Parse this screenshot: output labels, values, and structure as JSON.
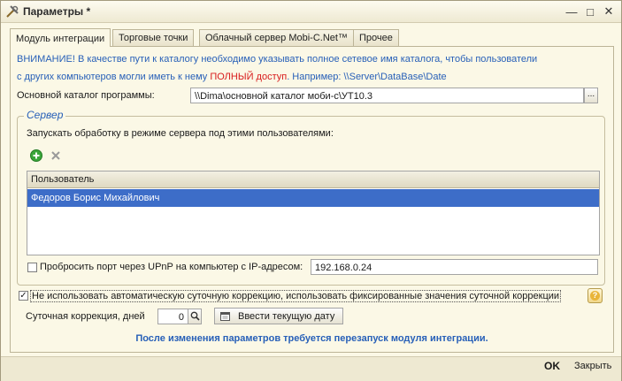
{
  "window": {
    "title": "Параметры *",
    "minimize_glyph": "—",
    "maximize_glyph": "□",
    "close_glyph": "✕"
  },
  "tabs": [
    {
      "label": "Модуль интеграции",
      "active": true
    },
    {
      "label": "Торговые точки",
      "active": false
    },
    {
      "label": "Облачный сервер Mobi-C.Net™",
      "active": false
    },
    {
      "label": "Прочее",
      "active": false
    }
  ],
  "warning": {
    "line1": "ВНИМАНИЕ! В качестве пути к каталогу необходимо указывать полное сетевое имя каталога, чтобы пользователи",
    "line2_start": "с других компьютеров могли иметь к нему ",
    "line2_red": "ПОЛНЫЙ доступ",
    "line2_end": ". Например: \\\\Server\\DataBase\\Date"
  },
  "catalog": {
    "label": "Основной каталог программы:",
    "value": "\\\\Dima\\основной каталог моби-с\\УТ10.3",
    "browse_label": "..."
  },
  "server": {
    "group_title": "Сервер",
    "instruction": "Запускать обработку в режиме сервера под этими пользователями:",
    "add_icon": "add-icon",
    "delete_icon": "delete-icon",
    "grid_header": "Пользователь",
    "users": [
      "Федоров Борис Михайлович"
    ],
    "upnp_label": "Пробросить порт через UPnP на компьютер с IP-адресом:",
    "upnp_checked": false,
    "ip_value": "192.168.0.24"
  },
  "correction": {
    "checkbox_label": "Не использовать автоматическую суточную коррекцию, использовать фиксированные значения суточной коррекции",
    "checked": true,
    "help_glyph": "?",
    "daily_label": "Суточная коррекция, дней",
    "daily_value": "0",
    "enter_date_label": "Ввести текущую дату"
  },
  "note": "После изменения параметров требуется перезапуск модуля интеграции.",
  "buttons": {
    "ok": "OK",
    "close": "Закрыть"
  },
  "colors": {
    "accent_blue": "#2860b8",
    "warning_red": "#d81c1c",
    "selection": "#3d6dc8",
    "add_green": "#3aa63a"
  }
}
